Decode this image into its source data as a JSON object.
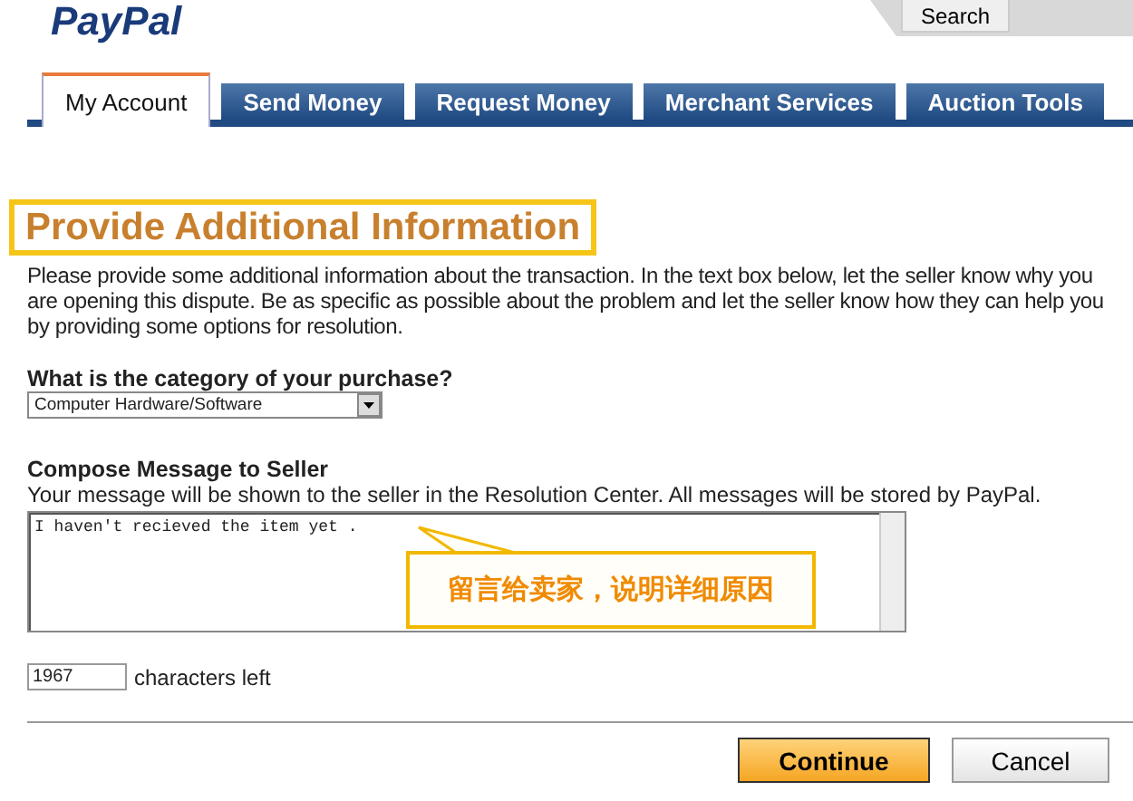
{
  "header": {
    "logo": "PayPal",
    "search_button": "Search"
  },
  "tabs": [
    {
      "label": "My Account",
      "selected": true
    },
    {
      "label": "Send Money",
      "selected": false
    },
    {
      "label": "Request Money",
      "selected": false
    },
    {
      "label": "Merchant Services",
      "selected": false
    },
    {
      "label": "Auction Tools",
      "selected": false
    }
  ],
  "heading": "Provide Additional Information",
  "intro": "Please provide some additional information about the transaction. In the text box below, let the seller know why you are opening this dispute. Be as specific as possible about the problem and let the seller know how they can help you by providing some options for resolution.",
  "category": {
    "label": "What is the category of your purchase?",
    "value": "Computer Hardware/Software"
  },
  "message": {
    "label": "Compose Message to Seller",
    "hint": "Your message will be shown to the seller in the Resolution Center. All messages will be stored by PayPal.",
    "value": "I haven't recieved the item yet ."
  },
  "callout": "留言给卖家，说明详细原因",
  "counter": {
    "value": "1967",
    "label": "characters left"
  },
  "buttons": [
    {
      "label": "Continue",
      "kind": "primary"
    },
    {
      "label": "Cancel",
      "kind": "secondary"
    }
  ]
}
